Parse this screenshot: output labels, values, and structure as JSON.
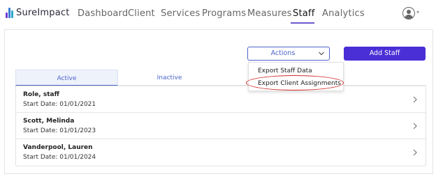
{
  "app": {
    "brand": "SureImpact",
    "brand_colors": [
      "#6f3bd6",
      "#3a7bd5",
      "#2aa7c9"
    ]
  },
  "nav": {
    "items": [
      "Dashboard",
      "Client",
      "Services",
      "Programs",
      "Measures",
      "Staff",
      "Analytics"
    ],
    "active": "Staff",
    "accent_color": "#6a5acd"
  },
  "toolbar": {
    "actions_label": "Actions",
    "add_label": "Add Staff"
  },
  "actions_menu": {
    "items": [
      "Export Staff Data",
      "Export Client Assignments"
    ],
    "highlighted": "Export Client Assignments"
  },
  "tabs": {
    "items": [
      "Active",
      "Inactive"
    ],
    "selected": "Active"
  },
  "staff": [
    {
      "name": "Role, staff",
      "start_date": "Start Date: 01/01/2021"
    },
    {
      "name": "Scott, Melinda",
      "start_date": "Start Date: 01/01/2023"
    },
    {
      "name": "Vanderpool, Lauren",
      "start_date": "Start Date: 01/01/2024"
    }
  ],
  "icons": {
    "avatar": "user-avatar-icon",
    "actions_chevron": "chevron-down-icon",
    "row_chevron": "chevron-right-icon"
  }
}
